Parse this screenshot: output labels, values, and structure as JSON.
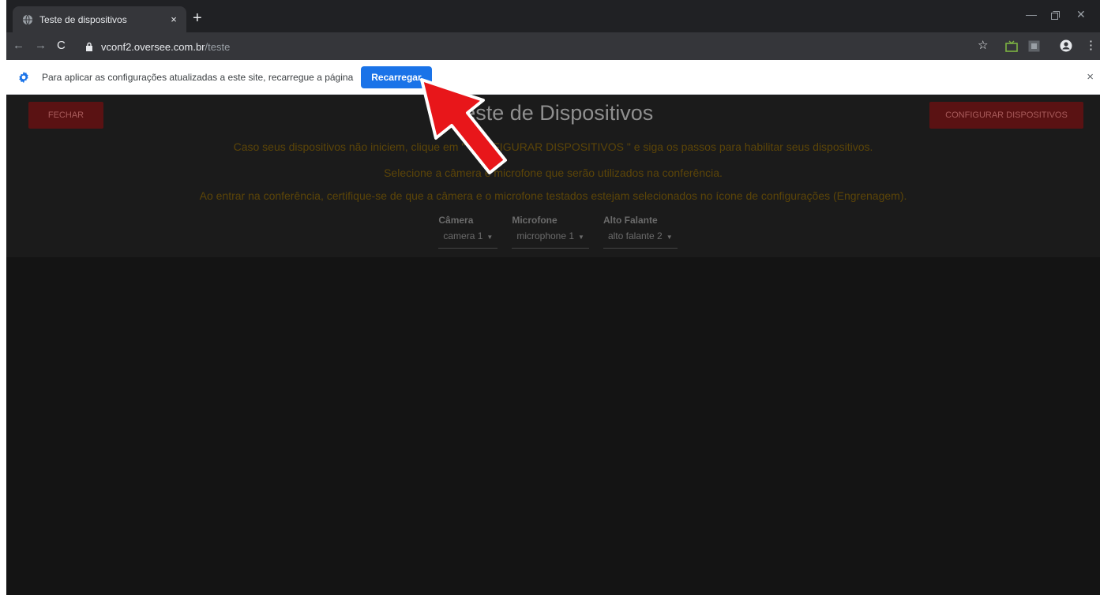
{
  "browser": {
    "tab_title": "Teste de dispositivos",
    "tab_close": "×",
    "new_tab": "+",
    "url_host": "vconf2.oversee.com.br",
    "url_path": "/teste"
  },
  "infobar": {
    "message": "Para aplicar as configurações atualizadas a este site, recarregue a página",
    "button": "Recarregar",
    "close": "×"
  },
  "app": {
    "title": "Teste de Dispositivos",
    "close_button": "FECHAR",
    "config_button": "CONFIGURAR DISPOSITIVOS",
    "instructions": [
      "Caso seus dispositivos não iniciem, clique em \" CONFIGURAR DISPOSITIVOS \" e siga os passos para habilitar seus dispositivos.",
      "Selecione a câmera e microfone que serão utilizados na conferência.",
      "Ao entrar na conferência, certifique-se de que a câmera e o microfone testados estejam selecionados no ícone de configurações (Engrenagem)."
    ],
    "selects": {
      "camera": {
        "label": "Câmera",
        "value": "camera 1"
      },
      "microphone": {
        "label": "Microfone",
        "value": "microphone 1"
      },
      "speaker": {
        "label": "Alto Falante",
        "value": "alto falante 2"
      }
    }
  },
  "icons": {
    "caret": "▼"
  },
  "colors": {
    "accent_blue": "#1a73e8",
    "button_red": "#5a1213",
    "instruction_text": "#5c4508",
    "arrow_red": "#e8161a"
  }
}
